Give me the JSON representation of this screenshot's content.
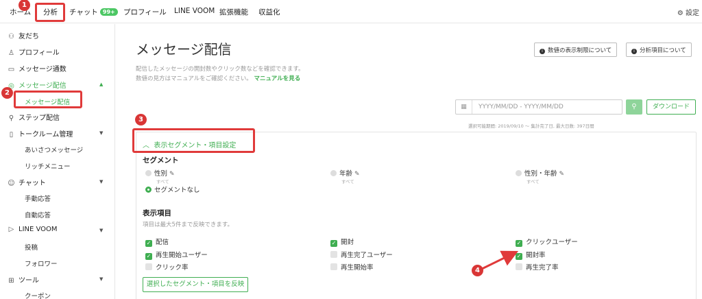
{
  "topnav": {
    "home": "ホーム",
    "analytics": "分析",
    "chat": "チャット",
    "chat_badge": "99+",
    "profile": "プロフィール",
    "line_voom": "LINE VOOM",
    "extensions": "拡張機能",
    "monetize": "収益化",
    "settings": "設定"
  },
  "sidebar": {
    "friends": "友だち",
    "profile": "プロフィール",
    "message_count": "メッセージ通数",
    "message_delivery": "メッセージ配信",
    "message_delivery_sub": "メッセージ配信",
    "step_delivery": "ステップ配信",
    "talkroom": "トークルーム管理",
    "greeting": "あいさつメッセージ",
    "rich_menu": "リッチメニュー",
    "chat": "チャット",
    "manual_reply": "手動応答",
    "auto_reply": "自動応答",
    "line_voom": "LINE VOOM",
    "posts": "投稿",
    "followers": "フォロワー",
    "tools": "ツール",
    "coupon": "クーポン"
  },
  "main": {
    "title": "メッセージ配信",
    "desc_line1": "配信したメッセージの開封数やクリック数などを確認できます。",
    "desc_line2": "数値の見方はマニュアルをご確認ください。",
    "manual_link": "マニュアルを見る",
    "btn_limits": "数値の表示制限について",
    "btn_items": "分析項目について",
    "date_placeholder": "YYYY/MM/DD - YYYY/MM/DD",
    "download": "ダウンロード",
    "range_note": "選択可能期間: 2019/09/10 〜 集計完了日, 最大日数: 397日間",
    "panel_toggle": "表示セグメント・項目設定",
    "segment_title": "セグメント",
    "seg_gender": "性別",
    "seg_age": "年齢",
    "seg_gender_age": "性別・年齢",
    "seg_all": "すべて",
    "seg_none": "セグメントなし",
    "items_title": "表示項目",
    "items_note": "項目は最大5件まで反映できます。",
    "items": {
      "delivery": "配信",
      "open": "開封",
      "click_users": "クリックユーザー",
      "play_start_users": "再生開始ユーザー",
      "play_complete_users": "再生完了ユーザー",
      "open_rate": "開封率",
      "click_rate": "クリック率",
      "play_start_rate": "再生開始率",
      "play_complete_rate": "再生完了率"
    },
    "apply": "選択したセグメント・項目を反映"
  },
  "annotations": {
    "n1": "1",
    "n2": "2",
    "n3": "3",
    "n4": "4",
    "color": "#e03a3a"
  },
  "colors": {
    "accent": "#3fae51",
    "badge": "#4cc764"
  }
}
